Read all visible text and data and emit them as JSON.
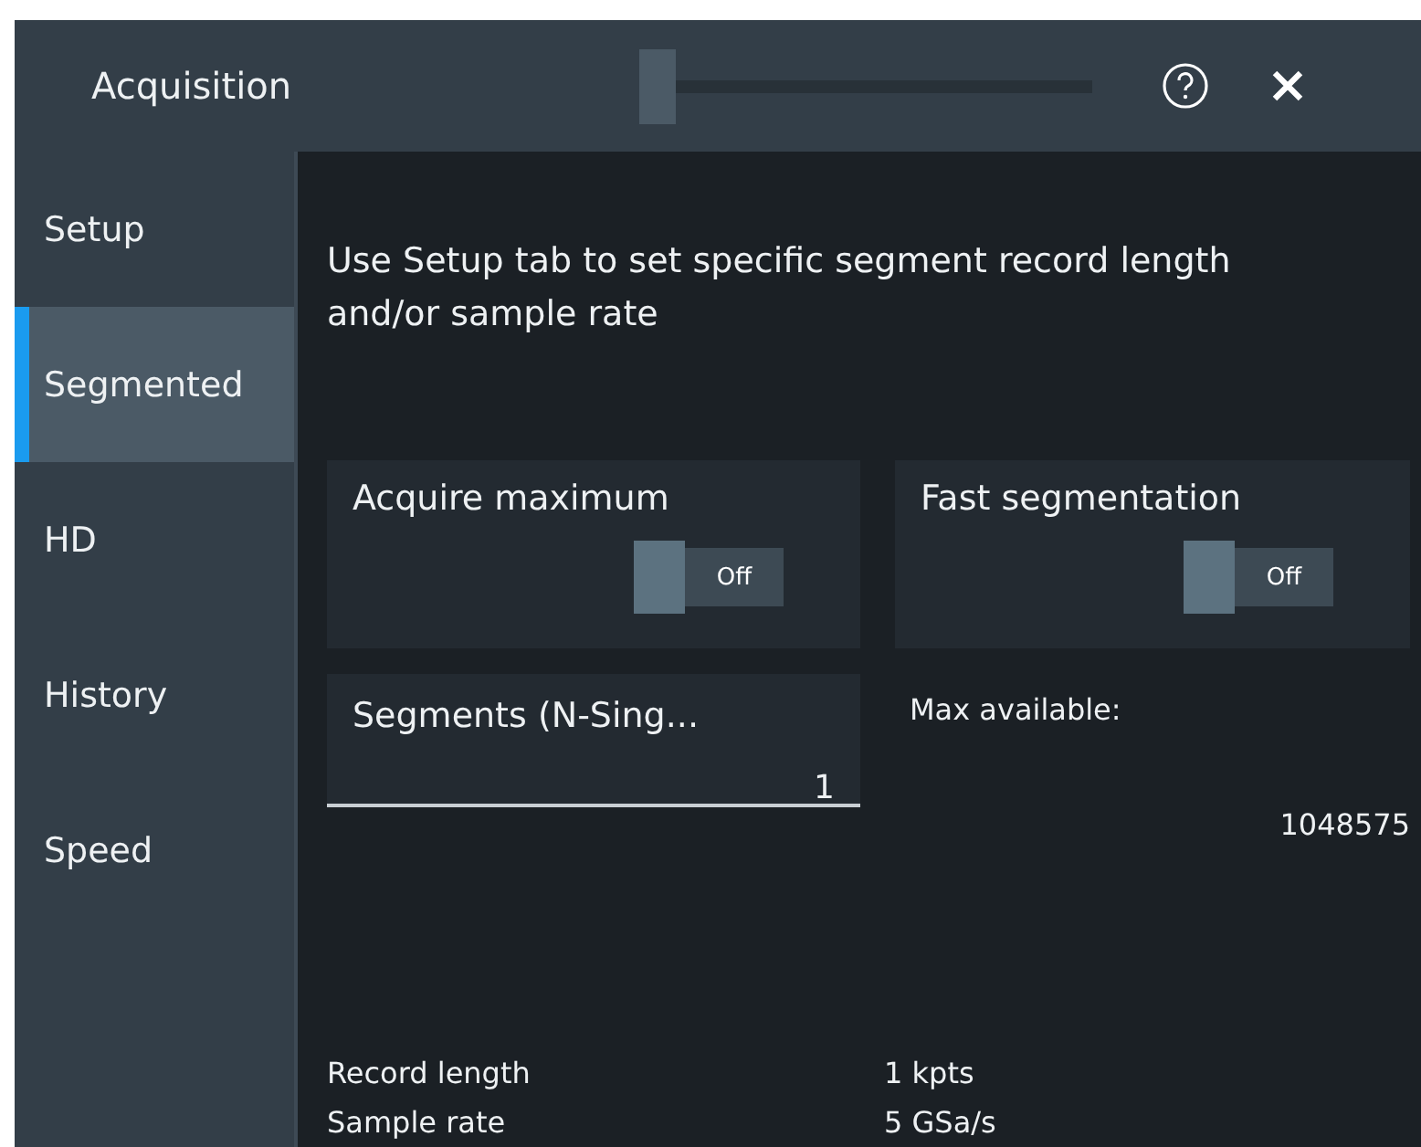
{
  "window": {
    "title": "Acquisition"
  },
  "tabs": [
    {
      "label": "Setup",
      "selected": false
    },
    {
      "label": "Segmented",
      "selected": true
    },
    {
      "label": "HD",
      "selected": false
    },
    {
      "label": "History",
      "selected": false
    },
    {
      "label": "Speed",
      "selected": false
    }
  ],
  "hint": "Use Setup tab to set specific segment record length and/or sample rate",
  "toggles": [
    {
      "label": "Acquire maximum",
      "on": false,
      "state_text": "Off"
    },
    {
      "label": "Fast segmentation",
      "on": false,
      "state_text": "Off"
    }
  ],
  "segments": {
    "label": "Segments (N-Sing...",
    "value": "1"
  },
  "max_available": {
    "label": "Max available:",
    "value": "1048575"
  },
  "info": [
    {
      "label": "Record length",
      "value": "1 kpts"
    },
    {
      "label": "Sample rate",
      "value": "5 GSa/s"
    }
  ]
}
